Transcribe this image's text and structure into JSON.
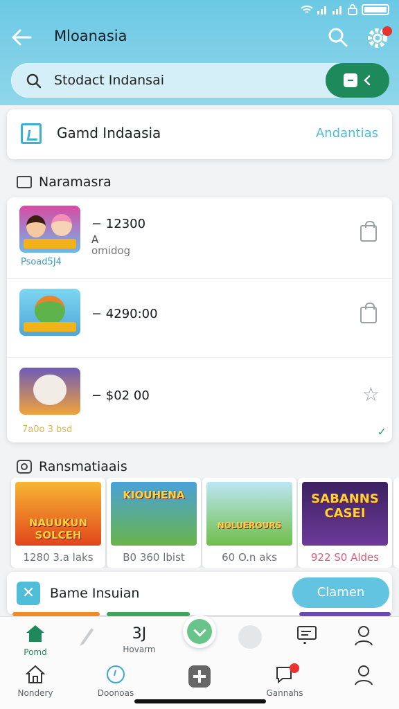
{
  "header": {
    "title": "Mloanasia",
    "search_text": "Stodact Indansai"
  },
  "game_card": {
    "title": "Gamd Indaasia",
    "link": "Andantias"
  },
  "section1": {
    "title": "Naramasra"
  },
  "list": [
    {
      "price": "− 12300",
      "sub1": "A",
      "sub2": "omidog",
      "caption": "Psoad5J4"
    },
    {
      "price": "− 4290:00"
    },
    {
      "price": "− $02 00",
      "caption": "7a0o 3 bsd"
    }
  ],
  "section2": {
    "title": "Ransmatiaais"
  },
  "promos": [
    {
      "title": "NAUUKUN SOLCEH",
      "caption": "1280 3.a laks",
      "bg": "#f38b1b"
    },
    {
      "title": "KIOUHENA",
      "caption": "B0 360 lbist",
      "bg": "#4aa1d8"
    },
    {
      "title": "NOLUEROURS",
      "caption": "60 O.n aks",
      "bg": "#8fcf6a"
    },
    {
      "title": "SABANNS CASEI",
      "caption": "922 S0 Aldes",
      "bg": "#4a2a6e"
    }
  ],
  "bame": {
    "title": "Bame Insuian",
    "button": "Clamen"
  },
  "nav_top": [
    {
      "label": "Pomd",
      "icon": "home-icon"
    },
    {
      "label": "",
      "icon": "brush-icon"
    },
    {
      "label": "Hovarm",
      "value": "3J",
      "icon": "count-icon"
    },
    {
      "label": "",
      "icon": "download-icon"
    },
    {
      "label": "",
      "icon": "circle-icon"
    },
    {
      "label": "",
      "icon": "message-icon"
    },
    {
      "label": "",
      "icon": "user-icon"
    }
  ],
  "nav_bottom": [
    {
      "label": "Nondery",
      "icon": "home-outline-icon"
    },
    {
      "label": "Doonoas",
      "icon": "clock-icon"
    },
    {
      "label": "",
      "icon": "plus-icon"
    },
    {
      "label": "Gannahs",
      "icon": "chat-icon"
    },
    {
      "label": "",
      "icon": "profile-icon"
    }
  ],
  "colors": {
    "accent": "#1e8a5c",
    "header": "#6cc9e4",
    "link": "#4fbcd8"
  }
}
